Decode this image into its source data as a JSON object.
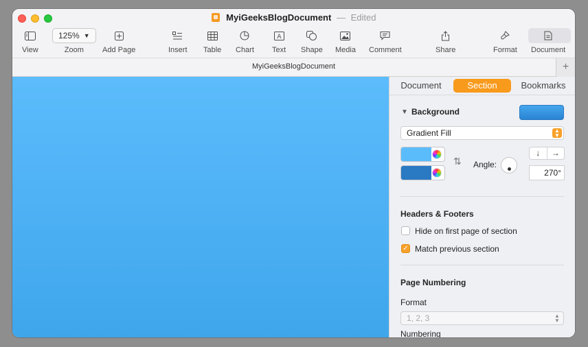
{
  "window": {
    "title": "MyiGeeksBlogDocument",
    "status": "Edited",
    "separator": "—"
  },
  "toolbar": {
    "view": "View",
    "zoom_value": "125%",
    "zoom": "Zoom",
    "add_page": "Add Page",
    "insert": "Insert",
    "table": "Table",
    "chart": "Chart",
    "text": "Text",
    "shape": "Shape",
    "media": "Media",
    "comment": "Comment",
    "share": "Share",
    "format": "Format",
    "document": "Document"
  },
  "subheader": {
    "doc_name": "MyiGeeksBlogDocument",
    "plus": "+"
  },
  "inspector": {
    "tabs": [
      "Document",
      "Section",
      "Bookmarks"
    ],
    "active_tab": "Section",
    "background": {
      "heading": "Background",
      "fill_type": "Gradient Fill",
      "color_start": "#5bbcfc",
      "color_end": "#2a79c3",
      "angle_label": "Angle:",
      "angle_value": "270°"
    },
    "headers_footers": {
      "heading": "Headers & Footers",
      "hide_first": "Hide on first page of section",
      "hide_first_checked": false,
      "match_previous": "Match previous section",
      "match_previous_checked": true
    },
    "page_numbering": {
      "heading": "Page Numbering",
      "format_label": "Format",
      "format_value": "1, 2, 3",
      "numbering_label": "Numbering"
    }
  },
  "colors": {
    "accent": "#f89a1c",
    "canvas_top": "#5cbcfc",
    "canvas_bottom": "#3fa6ec"
  }
}
